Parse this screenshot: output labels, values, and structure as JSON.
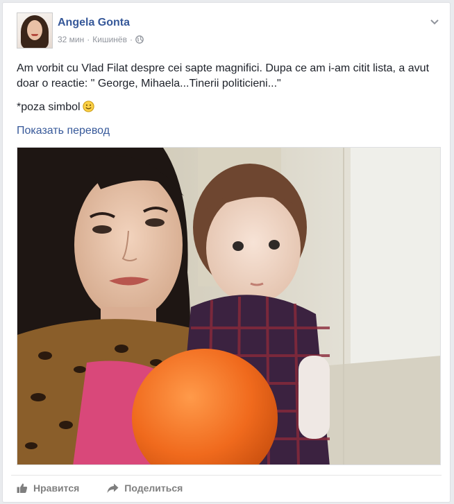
{
  "post": {
    "author": "Angela Gonta",
    "time": "32 мин",
    "separator": "·",
    "location": "Кишинёв",
    "audience_icon": "globe-icon",
    "text_line1": "Am vorbit cu Vlad Filat despre cei sapte magnifici. Dupa ce am i-am citit lista, a avut doar o reactie: \" George, Mihaela...Tinerii politicieni...\"",
    "text_line2": "*poza simbol",
    "emoji": "smiley-icon",
    "translate_link": "Показать перевод"
  },
  "actions": {
    "like_label": "Нравится",
    "share_label": "Поделиться"
  },
  "colors": {
    "link": "#365899",
    "text": "#1d2129",
    "meta": "#90949c",
    "action": "#7f7f7f",
    "balloon": "#f06a1d"
  }
}
